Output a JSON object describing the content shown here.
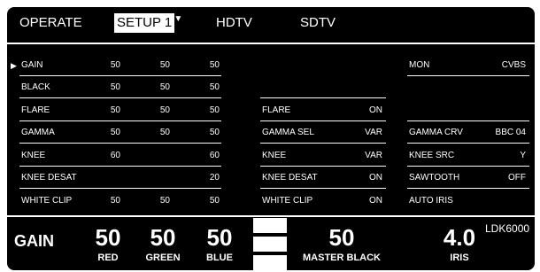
{
  "tabs": [
    {
      "label": "OPERATE",
      "active": false
    },
    {
      "label": "SETUP 1",
      "active": true
    },
    {
      "label": "HDTV",
      "active": false
    },
    {
      "label": "SDTV",
      "active": false
    }
  ],
  "selected_row_marker": "▶",
  "left_rows": [
    {
      "label": "GAIN",
      "r": "50",
      "g": "50",
      "b": "50"
    },
    {
      "label": "BLACK",
      "r": "50",
      "g": "50",
      "b": "50"
    },
    {
      "label": "FLARE",
      "r": "50",
      "g": "50",
      "b": "50"
    },
    {
      "label": "GAMMA",
      "r": "50",
      "g": "50",
      "b": "50"
    },
    {
      "label": "KNEE",
      "r": "60",
      "g": "",
      "b": "60"
    },
    {
      "label": "KNEE DESAT",
      "r": "",
      "g": "",
      "b": "20"
    },
    {
      "label": "WHITE CLIP",
      "r": "50",
      "g": "50",
      "b": "50"
    }
  ],
  "mid_rows": [
    {
      "label": "FLARE",
      "value": "ON"
    },
    {
      "label": "GAMMA SEL",
      "value": "VAR"
    },
    {
      "label": "KNEE",
      "value": "VAR"
    },
    {
      "label": "KNEE DESAT",
      "value": "ON"
    },
    {
      "label": "WHITE CLIP",
      "value": "ON"
    }
  ],
  "right_rows": [
    {
      "label": "MON",
      "value": "CVBS"
    },
    {
      "label": "GAMMA CRV",
      "value": "BBC 04"
    },
    {
      "label": "KNEE SRC",
      "value": "Y"
    },
    {
      "label": "SAWTOOTH",
      "value": "OFF"
    },
    {
      "label": "AUTO IRIS",
      "value": ""
    }
  ],
  "bottom": {
    "param": "GAIN",
    "red_value": "50",
    "red_label": "RED",
    "green_value": "50",
    "green_label": "GREEN",
    "blue_value": "50",
    "blue_label": "BLUE",
    "master_value": "50",
    "master_label": "MASTER BLACK",
    "iris_value": "4.0",
    "iris_label": "IRIS",
    "model": "LDK6000"
  }
}
